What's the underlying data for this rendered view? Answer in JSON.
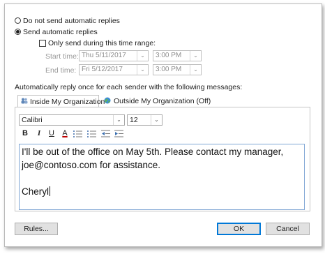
{
  "options": {
    "no_auto_replies": "Do not send automatic replies",
    "send_auto_replies": "Send automatic replies",
    "only_time_range": "Only send during this time range:"
  },
  "time_range": {
    "start_label": "Start time:",
    "start_date": "Thu 5/11/2017",
    "start_time": "3:00 PM",
    "end_label": "End time:",
    "end_date": "Fri 5/12/2017",
    "end_time": "3:00 PM"
  },
  "reply_description": "Automatically reply once for each sender with the following messages:",
  "tabs": [
    {
      "label": "Inside My Organization",
      "active": true
    },
    {
      "label": "Outside My Organization (Off)",
      "active": false
    }
  ],
  "format": {
    "font": "Calibri",
    "size": "12",
    "bold": "B",
    "italic": "I",
    "underline": "U",
    "font_color": "A"
  },
  "message": {
    "line1": "I'll be out of the office on May 5th. Please contact my manager,",
    "line2": "joe@contoso.com for assistance.",
    "line3": "",
    "line4": "Cheryl"
  },
  "buttons": {
    "rules": "Rules...",
    "ok": "OK",
    "cancel": "Cancel"
  },
  "colors": {
    "accent": "#0078d7",
    "font_color_underline": "#c00000"
  }
}
